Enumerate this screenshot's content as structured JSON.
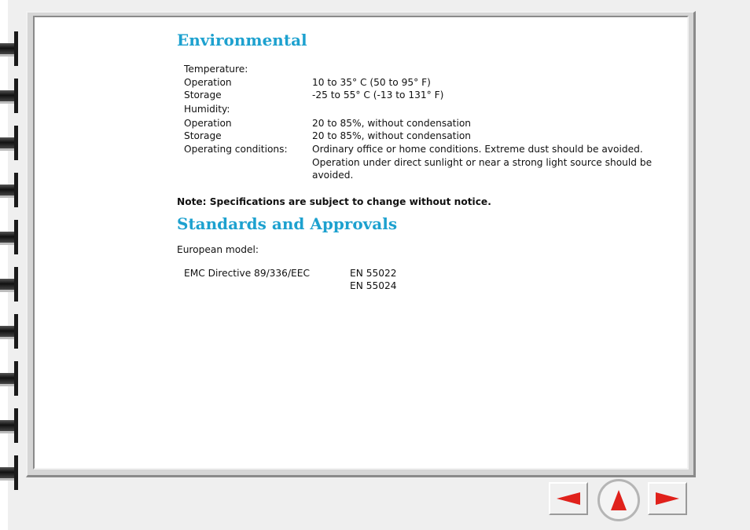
{
  "sections": {
    "environmental": {
      "title": "Environmental",
      "temperature_label": "Temperature:",
      "temp_operation_label": "Operation",
      "temp_operation_value": "10 to 35° C (50 to 95° F)",
      "temp_storage_label": "Storage",
      "temp_storage_value": "-25 to 55° C (-13 to 131° F)",
      "humidity_label": "Humidity:",
      "hum_operation_label": "Operation",
      "hum_operation_value": "20 to 85%, without condensation",
      "hum_storage_label": "Storage",
      "hum_storage_value": "20 to 85%, without condensation",
      "conditions_label": "Operating conditions:",
      "conditions_value": "Ordinary office or home conditions. Extreme dust should be avoided. Operation under direct sunlight or near a strong light source should be avoided."
    },
    "note": "Note: Specifications are subject to change without notice.",
    "standards": {
      "title": "Standards and Approvals",
      "model_label": "European model:",
      "directive_label": "EMC Directive 89/336/EEC",
      "standard_1": "EN 55022",
      "standard_2": "EN 55024"
    }
  },
  "navigation": {
    "prev_icon": "left-arrow-icon",
    "up_icon": "up-arrow-icon",
    "next_icon": "right-arrow-icon",
    "arrow_color": "#e0211b"
  },
  "colors": {
    "heading": "#1da1cf",
    "background": "#efefef",
    "paper": "#ffffff"
  }
}
